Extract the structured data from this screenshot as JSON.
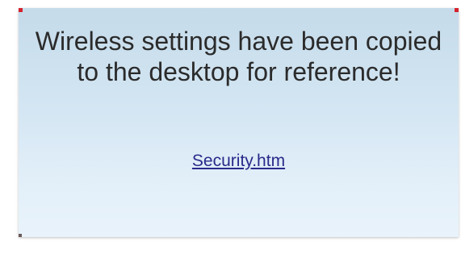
{
  "dialog": {
    "message": "Wireless settings have been copied to the desktop for reference!",
    "link_text": "Security.htm"
  }
}
